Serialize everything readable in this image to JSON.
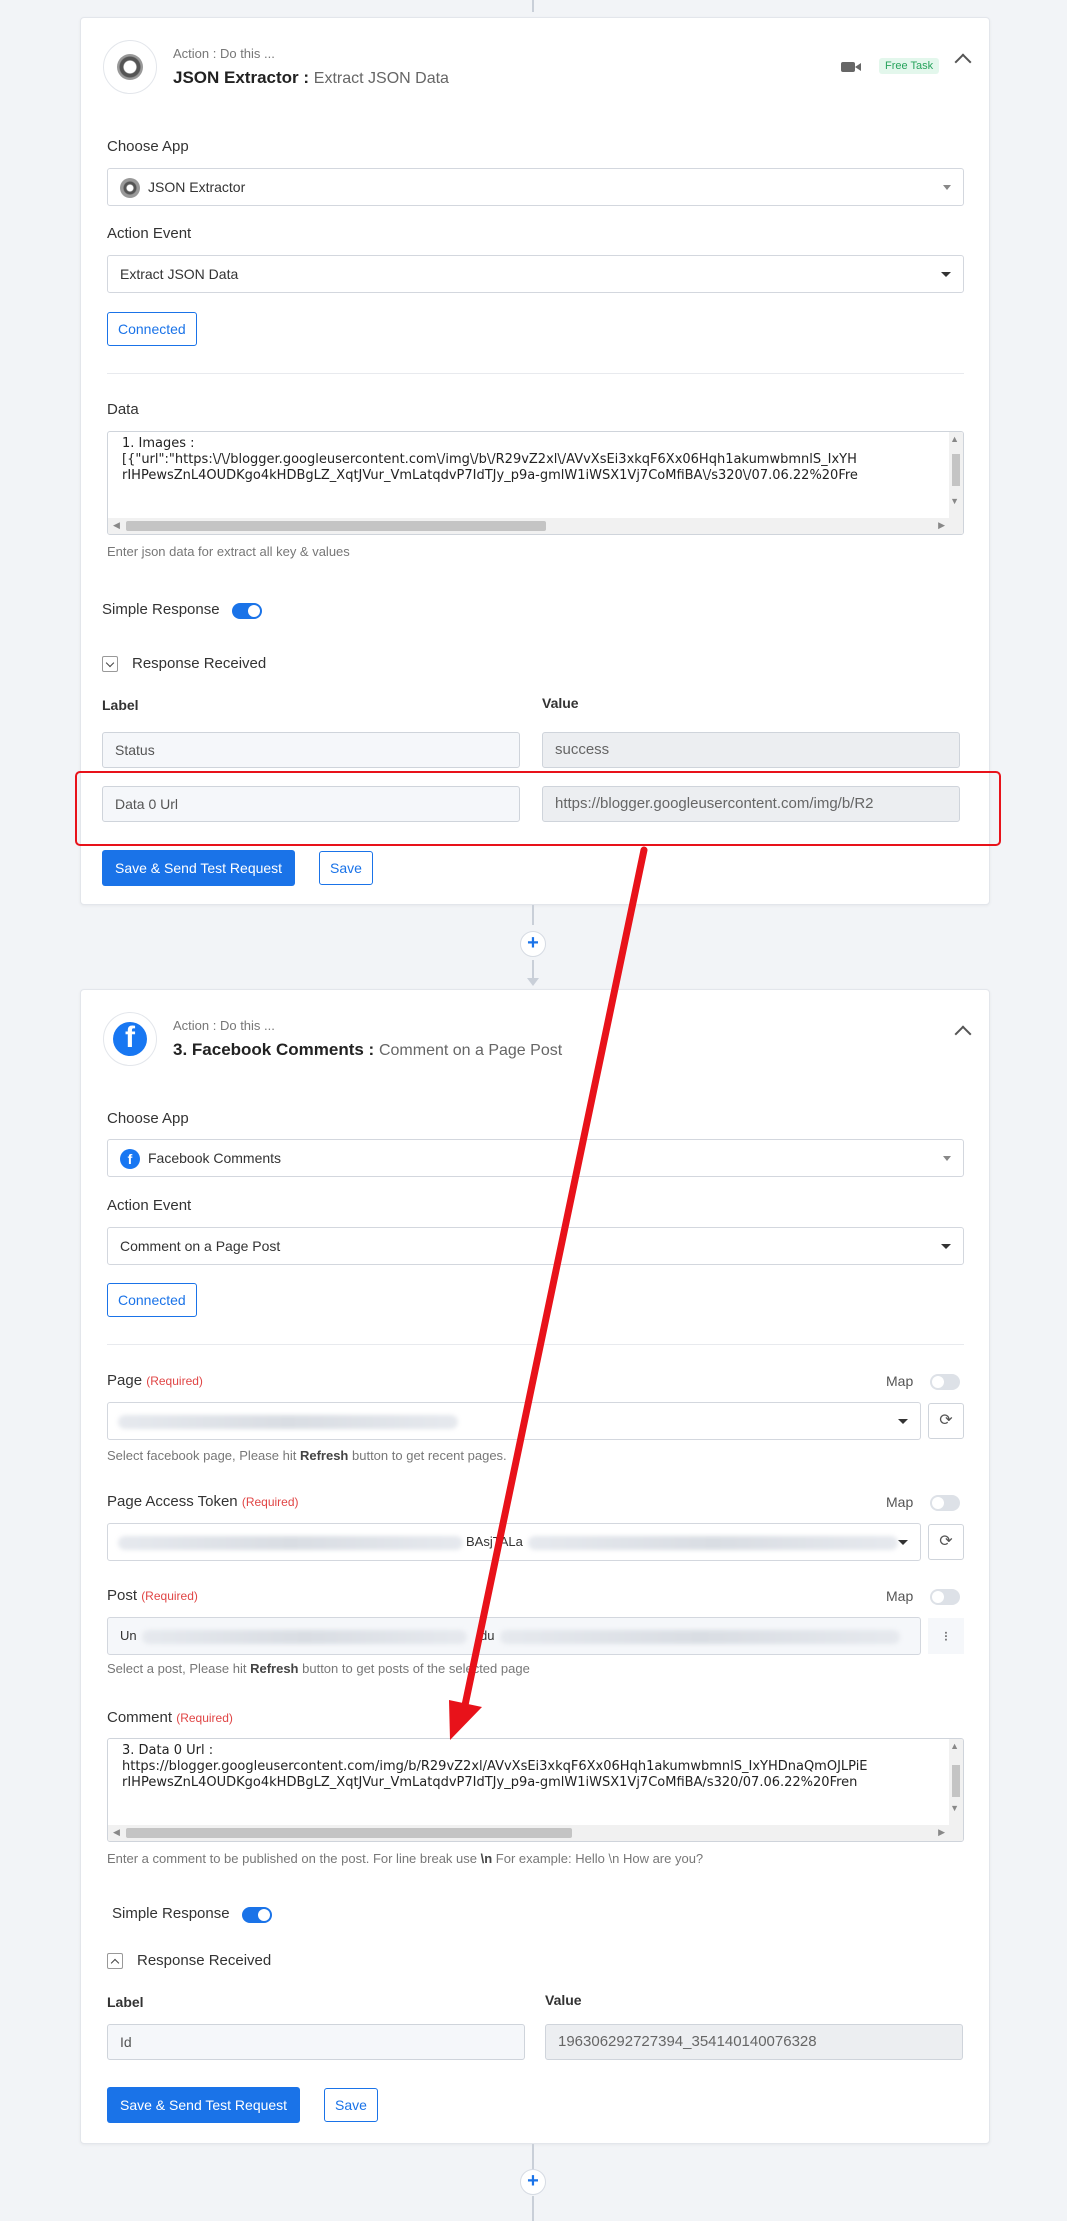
{
  "card1": {
    "action_sub": "Action : Do this ...",
    "app_name": "JSON Extractor :",
    "event_name": "Extract JSON Data",
    "badge": "Free Task",
    "choose_app_label": "Choose App",
    "app_selected": "JSON Extractor",
    "action_event_label": "Action Event",
    "event_selected": "Extract JSON Data",
    "connected_label": "Connected",
    "data_label": "Data",
    "data_text": "1. Images :\n[{\"url\":\"https:\\/\\/blogger.googleusercontent.com\\/img\\/b\\/R29vZ2xl\\/AVvXsEi3xkqF6Xx06Hqh1akumwbmnlS_IxYH\nrIHPewsZnL4OUDKgo4kHDBgLZ_XqtJVur_VmLatqdvP7IdTJy_p9a-gmlW1iWSX1Vj7CoMfiBA\\/s320\\/07.06.22%20Fre",
    "data_help": "Enter json data for extract all key & values",
    "simple_response_label": "Simple Response",
    "response_received_label": "Response Received",
    "label_header": "Label",
    "value_header": "Value",
    "rows": [
      {
        "label": "Status",
        "value": "success"
      },
      {
        "label": "Data 0 Url",
        "value": "https://blogger.googleusercontent.com/img/b/R2"
      }
    ],
    "save_send_label": "Save & Send Test Request",
    "save_label": "Save"
  },
  "card2": {
    "action_sub": "Action : Do this ...",
    "app_name": "3. Facebook Comments :",
    "event_name": "Comment on a Page Post",
    "choose_app_label": "Choose App",
    "app_selected": "Facebook Comments",
    "action_event_label": "Action Event",
    "event_selected": "Comment on a Page Post",
    "connected_label": "Connected",
    "page_label": "Page",
    "required": "(Required)",
    "map_label": "Map",
    "page_help_pre": "Select facebook page, Please hit ",
    "refresh_word": "Refresh",
    "page_help_post": " button to get recent pages.",
    "token_label": "Page Access Token",
    "token_visible": "BAsjTALa",
    "post_label": "Post",
    "post_visible_start": "Un",
    "post_visible_mid": "du",
    "post_help_pre": "Select a post, Please hit ",
    "post_help_post": " button to get posts of the selected page",
    "comment_label": "Comment",
    "comment_text": "3. Data 0 Url :\nhttps://blogger.googleusercontent.com/img/b/R29vZ2xl/AVvXsEi3xkqF6Xx06Hqh1akumwbmnlS_IxYHDnaQmOJLPiE\nrIHPewsZnL4OUDKgo4kHDBgLZ_XqtJVur_VmLatqdvP7IdTJy_p9a-gmlW1iWSX1Vj7CoMfiBA/s320/07.06.22%20Fren",
    "comment_help_pre": "Enter a comment to be published on the post. For line break use ",
    "comment_help_code": "\\n",
    "comment_help_post": " For example: Hello \\n How are you?",
    "simple_response_label": "Simple Response",
    "response_received_label": "Response Received",
    "label_header": "Label",
    "value_header": "Value",
    "rows": [
      {
        "label": "Id",
        "value": "196306292727394_354140140076328"
      }
    ],
    "save_send_label": "Save & Send Test Request",
    "save_label": "Save"
  },
  "colors": {
    "accent": "#1a73e8",
    "annotation": "#e8121a",
    "required": "#e04545",
    "badge_bg": "#e3f7ec",
    "badge_text": "#27a35c"
  }
}
